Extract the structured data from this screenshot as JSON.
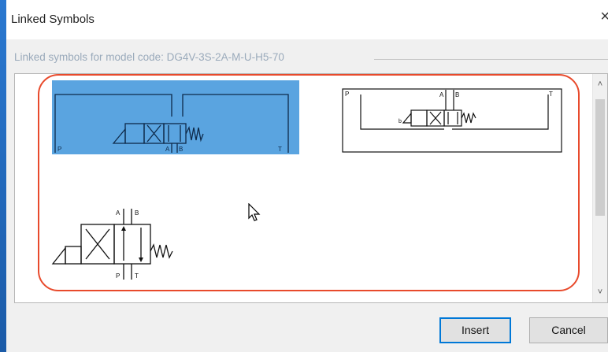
{
  "window": {
    "title": "Linked Symbols",
    "close_glyph": "×"
  },
  "group": {
    "label": "Linked symbols for model code: DG4V-3S-2A-M-U-H5-70"
  },
  "symbols": [
    {
      "id": "symbol-1",
      "selected": true,
      "ports": [
        "P",
        "A",
        "B",
        "T"
      ]
    },
    {
      "id": "symbol-2",
      "selected": false,
      "ports": [
        "P",
        "A",
        "B",
        "T",
        "b"
      ]
    },
    {
      "id": "symbol-3",
      "selected": false,
      "ports": [
        "A",
        "B",
        "P",
        "T"
      ]
    }
  ],
  "buttons": {
    "insert": "Insert",
    "cancel": "Cancel"
  },
  "scroll": {
    "up_glyph": "˄",
    "down_glyph": "˅"
  },
  "colors": {
    "selection": "#5aa4e0",
    "annotation": "#e84a2c",
    "titlebar_accent": "#1b5fb3"
  }
}
